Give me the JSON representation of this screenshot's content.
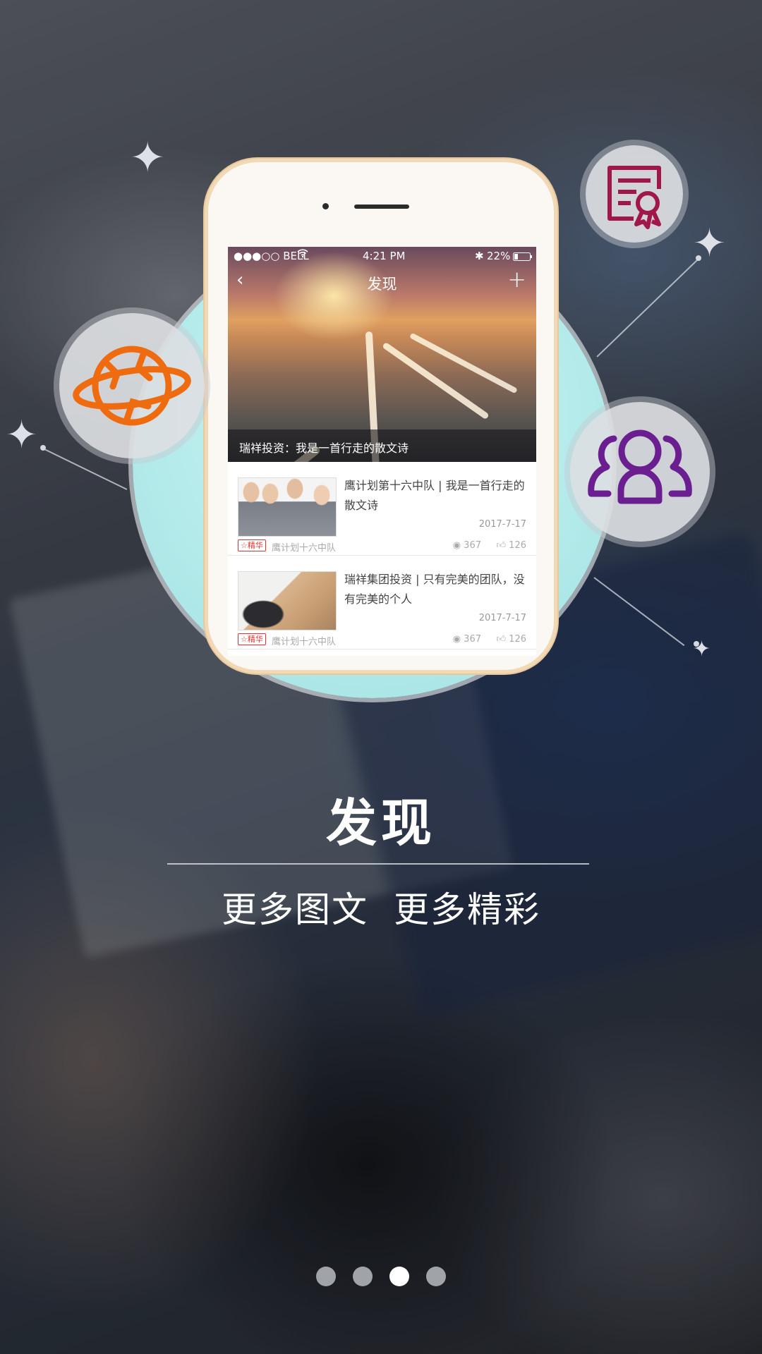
{
  "phone_screen": {
    "status_bar": {
      "carrier": "●●●○○ BELL",
      "wifi_icon": "wifi-icon",
      "time": "4:21 PM",
      "battery": "22%"
    },
    "nav": {
      "back_icon": "chevron-left-icon",
      "title": "发现",
      "add_icon": "plus-icon"
    },
    "banner_caption": "瑞祥投资：我是一首行走的散文诗",
    "articles": [
      {
        "title": "鹰计划第十六中队 | 我是一首行走的散文诗",
        "date": "2017-7-17",
        "badge": "精华",
        "source": "鹰计划十六中队",
        "views": "367",
        "likes": "126"
      },
      {
        "title": "瑞祥集团投资 | 只有完美的团队，没有完美的个人",
        "date": "2017-7-17",
        "badge": "精华",
        "source": "鹰计划十六中队",
        "views": "367",
        "likes": "126"
      }
    ]
  },
  "feature_icons": [
    "planet-icon",
    "certificate-icon",
    "group-icon"
  ],
  "headline": "发现",
  "subline": [
    "更多图文",
    "更多精彩"
  ],
  "pager": {
    "count": 4,
    "active_index": 2
  },
  "colors": {
    "planet": "#ee6b0f",
    "certificate": "#a0174a",
    "group": "#6a1e8f",
    "badge": "#d33333"
  }
}
